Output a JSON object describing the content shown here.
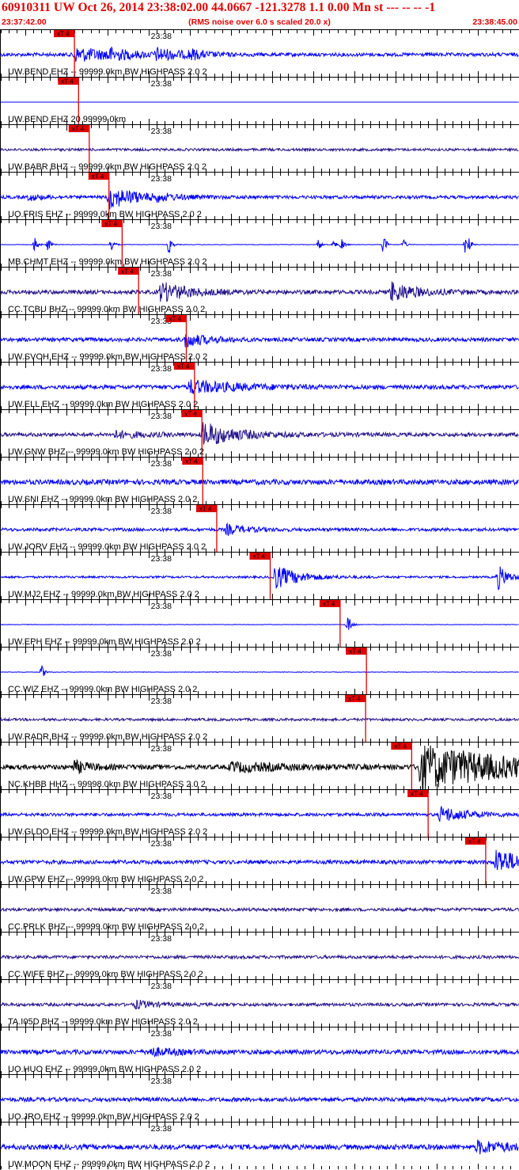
{
  "header": {
    "title": "60910311 UW Oct 26, 2014 23:38:02.00   44.0667 -121.3278  1.1 0.00 Mn st --- -- --   -1",
    "time_start": "23:37:42.00",
    "subtitle": "(RMS noise over 6.0 s scaled 20.0 x)",
    "time_end": "23:38:45.00"
  },
  "chart_data": {
    "type": "line",
    "title": "60910311 UW Oct 26, 2014 23:38:02.00   44.0667 -121.3278  1.1 0.00 Mn st --- -- --   -1",
    "x_start": "23:37:42.00",
    "x_end": "23:38:45.00",
    "minute_label": "23:38",
    "pick_label": "xT 4",
    "xlim_seconds_after_start": [
      0,
      63
    ],
    "series": [
      {
        "name": "UW.BEND EHZ -- 99999.0km BW  HIGHPASS  2.0  2",
        "color": "#0000ff",
        "pick": 9.0,
        "noise": 2.2,
        "events": [
          [
            9,
            9,
            5
          ],
          [
            13,
            6,
            2
          ],
          [
            19,
            7,
            3
          ],
          [
            23,
            5,
            1.5
          ]
        ]
      },
      {
        "name": "UW.BEND EHZ 20 99999.0km",
        "color": "#0000ff",
        "pick": 9.5,
        "noise": 0,
        "events": []
      },
      {
        "name": "UW.BABR BHZ -- 99999.0km BW  HIGHPASS  2.0  2",
        "color": "#22118a",
        "pick": 10.8,
        "noise": 1.6,
        "events": []
      },
      {
        "name": "UO.FRIS EHZ -- 99999.0km BW  HIGHPASS  2.0  2",
        "color": "#0000ff",
        "pick": 13.2,
        "noise": 2.0,
        "events": [
          [
            13.2,
            14,
            3.5
          ],
          [
            3.5,
            4,
            1.5
          ],
          [
            19,
            3,
            2
          ]
        ]
      },
      {
        "name": "MB.CHMT EHZ -- 99999.0km BW  HIGHPASS  2.0  2",
        "color": "#0000ff",
        "pick": 14.8,
        "noise": 0.3,
        "events": [
          [
            4.2,
            12,
            0.3
          ],
          [
            5.8,
            9,
            0.3
          ],
          [
            13.5,
            11,
            0.3
          ],
          [
            20.5,
            13,
            0.3
          ],
          [
            38.7,
            8,
            0.3
          ],
          [
            40.5,
            6,
            0.3
          ],
          [
            41.5,
            9,
            0.3
          ],
          [
            46.6,
            14,
            0.3
          ],
          [
            49,
            7,
            0.3
          ],
          [
            56.5,
            12,
            0.3
          ],
          [
            57,
            6,
            0.3
          ]
        ]
      },
      {
        "name": "CC.TCBU BHZ -- 99999.0km BW  HIGHPASS  2.0  2",
        "color": "#22118a",
        "pick": 16.8,
        "noise": 2.5,
        "events": [
          [
            19.5,
            12,
            3.5
          ],
          [
            47.5,
            12,
            3
          ]
        ]
      },
      {
        "name": "UW.SVOH EHZ -- 99999.0km BW  HIGHPASS  2.0  2",
        "color": "#0000ff",
        "pick": 22.6,
        "noise": 2.4,
        "events": [
          [
            22.5,
            9,
            2.5
          ]
        ]
      },
      {
        "name": "UW.ELL EHZ -- 99999.0km BW  HIGHPASS  2.0  2",
        "color": "#0000ff",
        "pick": 23.6,
        "noise": 2.6,
        "events": [
          [
            23,
            8,
            6
          ]
        ]
      },
      {
        "name": "UW.GNW BHZ -- 99999.0km BW  HIGHPASS  2.0  2",
        "color": "#22118a",
        "pick": 24.5,
        "noise": 2.4,
        "events": [
          [
            24.6,
            15,
            4
          ],
          [
            14,
            4,
            4
          ]
        ]
      },
      {
        "name": "UW.SNI EHZ -- 99999.0km BW  HIGHPASS  2.0  2",
        "color": "#0000ff",
        "pick": 24.6,
        "noise": 3.2,
        "events": []
      },
      {
        "name": "UW.JORV EHZ -- 99999.0km BW  HIGHPASS  2.0  2",
        "color": "#0000ff",
        "pick": 26.3,
        "noise": 2.0,
        "events": [
          [
            27.5,
            6,
            2.5
          ]
        ]
      },
      {
        "name": "UW.MJ2 EHZ -- 99999.0km BW  HIGHPASS  2.0  2",
        "color": "#0000ff",
        "pick": 32.8,
        "noise": 1.3,
        "events": [
          [
            33.3,
            15,
            3
          ],
          [
            60.5,
            15,
            1.2
          ]
        ]
      },
      {
        "name": "UW.EPH EHZ -- 99999.0km BW  HIGHPASS  2.0  2",
        "color": "#0000ff",
        "pick": 41.3,
        "noise": 0.3,
        "events": [
          [
            42.2,
            14,
            0.4
          ]
        ]
      },
      {
        "name": "CC.WIZ EHZ -- 99999.0km BW  HIGHPASS  2.0  2",
        "color": "#0000ff",
        "pick": 44.5,
        "noise": 0.3,
        "events": [
          [
            5,
            9,
            0.4
          ]
        ]
      },
      {
        "name": "UW.RADR BHZ -- 99999.0km BW  HIGHPASS  2.0  2",
        "color": "#22118a",
        "pick": 44.4,
        "noise": 1.6,
        "events": []
      },
      {
        "name": "NC.KHBB HHZ -- 99998.0km BW  HIGHPASS  2.0  2",
        "color": "#000000",
        "pick": 50.0,
        "noise": 3.0,
        "events": [
          [
            9,
            7,
            2
          ],
          [
            28,
            5,
            8
          ],
          [
            51,
            28,
            12
          ]
        ]
      },
      {
        "name": "UW.GLDO EHZ -- 99999.0km BW  HIGHPASS  2.0  2",
        "color": "#0000ff",
        "pick": 52.0,
        "noise": 2.0,
        "events": [
          [
            53.5,
            10,
            3
          ]
        ]
      },
      {
        "name": "UW.GPW EHZ -- 99999.0km BW  HIGHPASS  2.0  2",
        "color": "#0000ff",
        "pick": 59.0,
        "noise": 2.4,
        "events": [
          [
            60.3,
            17,
            3
          ]
        ]
      },
      {
        "name": "CC.PRLK BHZ -- 99999.0km BW  HIGHPASS  2.0  2",
        "color": "#22118a",
        "pick": null,
        "noise": 2.0,
        "events": []
      },
      {
        "name": "CC.WIFE BHZ -- 99999.0km BW  HIGHPASS  2.0  2",
        "color": "#22118a",
        "pick": null,
        "noise": 2.0,
        "events": []
      },
      {
        "name": "TA.I05D BHZ -- 99999.0km BW  HIGHPASS  2.0  2",
        "color": "#22118a",
        "pick": null,
        "noise": 2.0,
        "events": [
          [
            16.5,
            5,
            2
          ]
        ]
      },
      {
        "name": "UO.HUO EHZ -- 99999.0km BW  HIGHPASS  2.0  2",
        "color": "#0000ff",
        "pick": null,
        "noise": 2.8,
        "events": [
          [
            18,
            5,
            3
          ]
        ]
      },
      {
        "name": "UO.JRO EHZ -- 99999.0km BW  HIGHPASS  2.0  2",
        "color": "#0000ff",
        "pick": null,
        "noise": 2.6,
        "events": []
      },
      {
        "name": "UW.MOON EHZ -- 99999.0km BW  HIGHPASS  2.0  2",
        "color": "#0000ff",
        "pick": null,
        "noise": 3.2,
        "events": [
          [
            58,
            7,
            4
          ]
        ]
      }
    ]
  }
}
